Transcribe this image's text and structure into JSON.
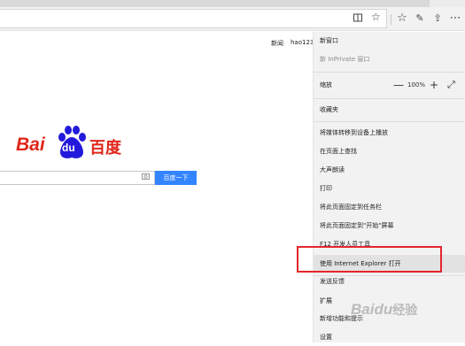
{
  "toolbar": {
    "reading_view_icon": "reading-view-icon",
    "favorite_icon": "star-icon",
    "favorites_icon": "favorites-hub-icon",
    "notes_icon": "web-note-icon",
    "share_icon": "share-icon",
    "more_icon": "more-icon"
  },
  "page": {
    "links": [
      "新闻",
      "hao123"
    ],
    "logo_bai": "Bai",
    "logo_du": "du",
    "logo_cn": "百度",
    "search_button": "百度一下"
  },
  "menu": {
    "new_window": "新窗口",
    "new_inprivate": "新 InPrivate 窗口",
    "zoom_label": "缩放",
    "zoom_minus": "—",
    "zoom_value": "100%",
    "zoom_plus": "+",
    "fullscreen_icon": "fullscreen-icon",
    "favorites": "收藏夹",
    "cast": "将媒体转移到设备上播放",
    "find": "在页面上查找",
    "read_aloud": "大声朗读",
    "print": "打印",
    "pin_taskbar": "将此页面固定到任务栏",
    "pin_start": "将此页面固定到\"开始\"屏幕",
    "devtools": "F12 开发人员工具",
    "open_ie": "使用 Internet Explorer 打开",
    "feedback": "发送反馈",
    "extensions": "扩展",
    "whats_new": "新增功能和提示",
    "settings": "设置"
  },
  "watermark": {
    "latin": "Bai",
    "du": "du",
    "cn": "经验"
  },
  "colors": {
    "baidu_red": "#e1251b",
    "search_blue": "#3385ff",
    "highlight_red": "#e3262d"
  }
}
